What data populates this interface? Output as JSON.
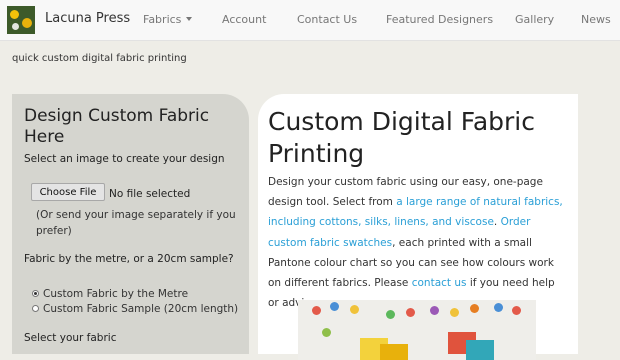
{
  "navbar": {
    "brand": "Lacuna Press",
    "items": [
      {
        "label": "Fabrics",
        "dropdown": true
      },
      {
        "label": "Account"
      },
      {
        "label": "Contact Us"
      },
      {
        "label": "Featured Designers"
      },
      {
        "label": "Gallery"
      },
      {
        "label": "News"
      }
    ]
  },
  "tagline": "quick custom digital fabric printing",
  "sidebar": {
    "title": "Design Custom Fabric Here",
    "image_label": "Select an image to create your design",
    "choose_file": "Choose File",
    "no_file": "No file selected",
    "note": "(Or send your image separately if you prefer)",
    "fabric_question": "Fabric by the metre, or a 20cm sample?",
    "options": [
      {
        "label": "Custom Fabric by the Metre",
        "checked": true
      },
      {
        "label": "Custom Fabric Sample (20cm length)",
        "checked": false
      }
    ],
    "select_fabric": "Select your fabric"
  },
  "main": {
    "title": "Custom Digital Fabric Printing",
    "text_1": "Design your custom fabric using our easy, one-page design tool. Select from ",
    "link_1": "a large range of natural fabrics, including cottons, silks, linens, and viscose",
    "text_2": ". ",
    "link_2": "Order custom fabric swatches",
    "text_3": ", each printed with a small Pantone colour chart so you can see how colours work on different fabrics. Please ",
    "link_3": "contact us",
    "text_4": " if you need help or advice."
  },
  "colors": {
    "link": "#2a9fd6",
    "sidebar_bg": "#d5d5cf",
    "page_bg": "#eeede7"
  }
}
